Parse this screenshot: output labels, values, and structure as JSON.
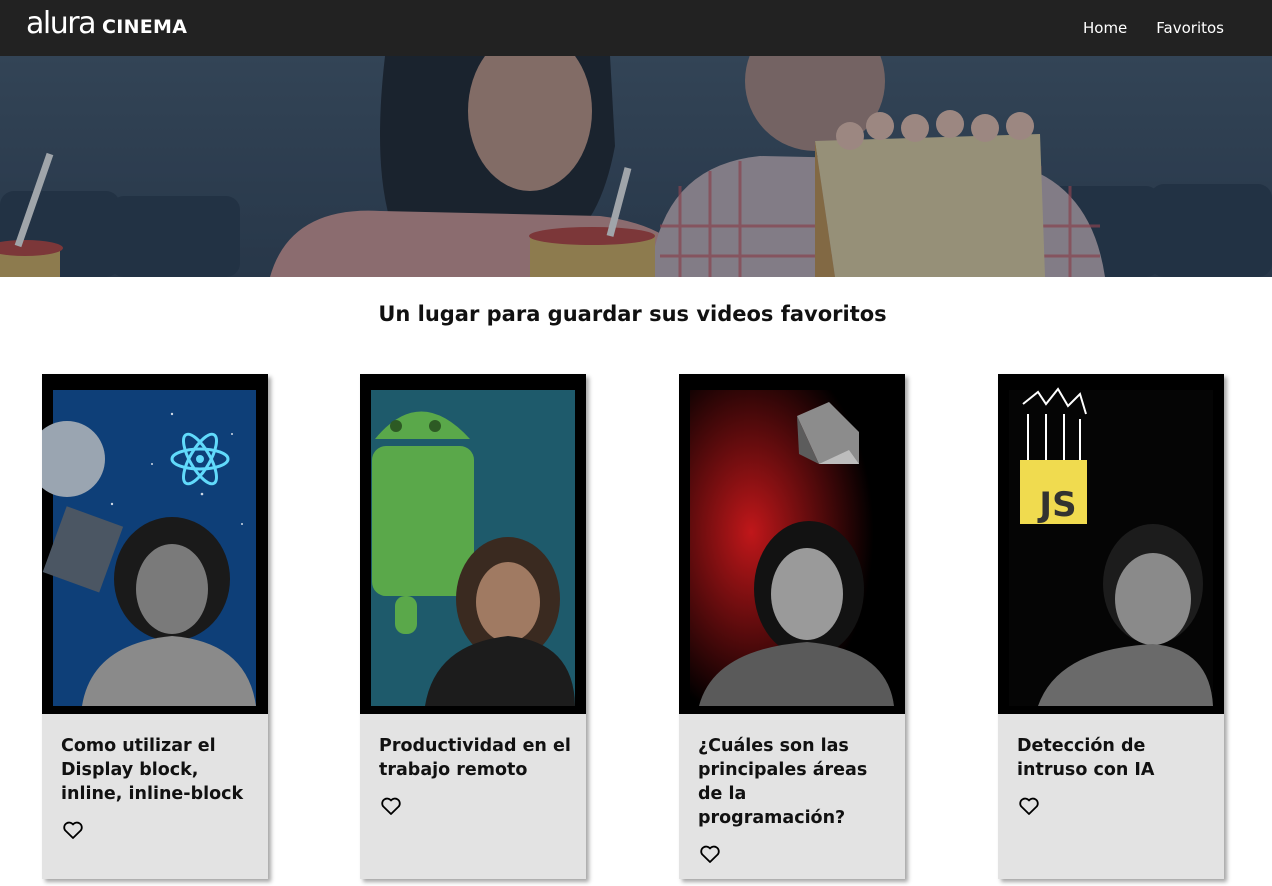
{
  "header": {
    "logo_main": "alura",
    "logo_sub": "CINEMA",
    "nav": {
      "home": "Home",
      "favorites": "Favoritos"
    },
    "background": "#222222"
  },
  "main": {
    "title": "Un lugar para guardar sus videos favoritos"
  },
  "cards": [
    {
      "title": "Como utilizar el Display block, inline, inline-block",
      "thumbnail_icon": "react-atom-icon",
      "favorite_icon": "heart-outline-icon"
    },
    {
      "title": "Productividad en el trabajo remoto",
      "thumbnail_icon": "android-icon",
      "favorite_icon": "heart-outline-icon"
    },
    {
      "title": "¿Cuáles son las principales áreas de la programación?",
      "thumbnail_icon": "dart-logo-icon",
      "favorite_icon": "heart-outline-icon"
    },
    {
      "title": "Detección de intruso con IA",
      "thumbnail_icon": "js-logo-icon",
      "favorite_icon": "heart-outline-icon"
    }
  ],
  "colors": {
    "card_background": "#e3e3e3",
    "react_accent": "#61dafb",
    "js_yellow": "#f0db4f"
  },
  "js_badge_text": "JS"
}
